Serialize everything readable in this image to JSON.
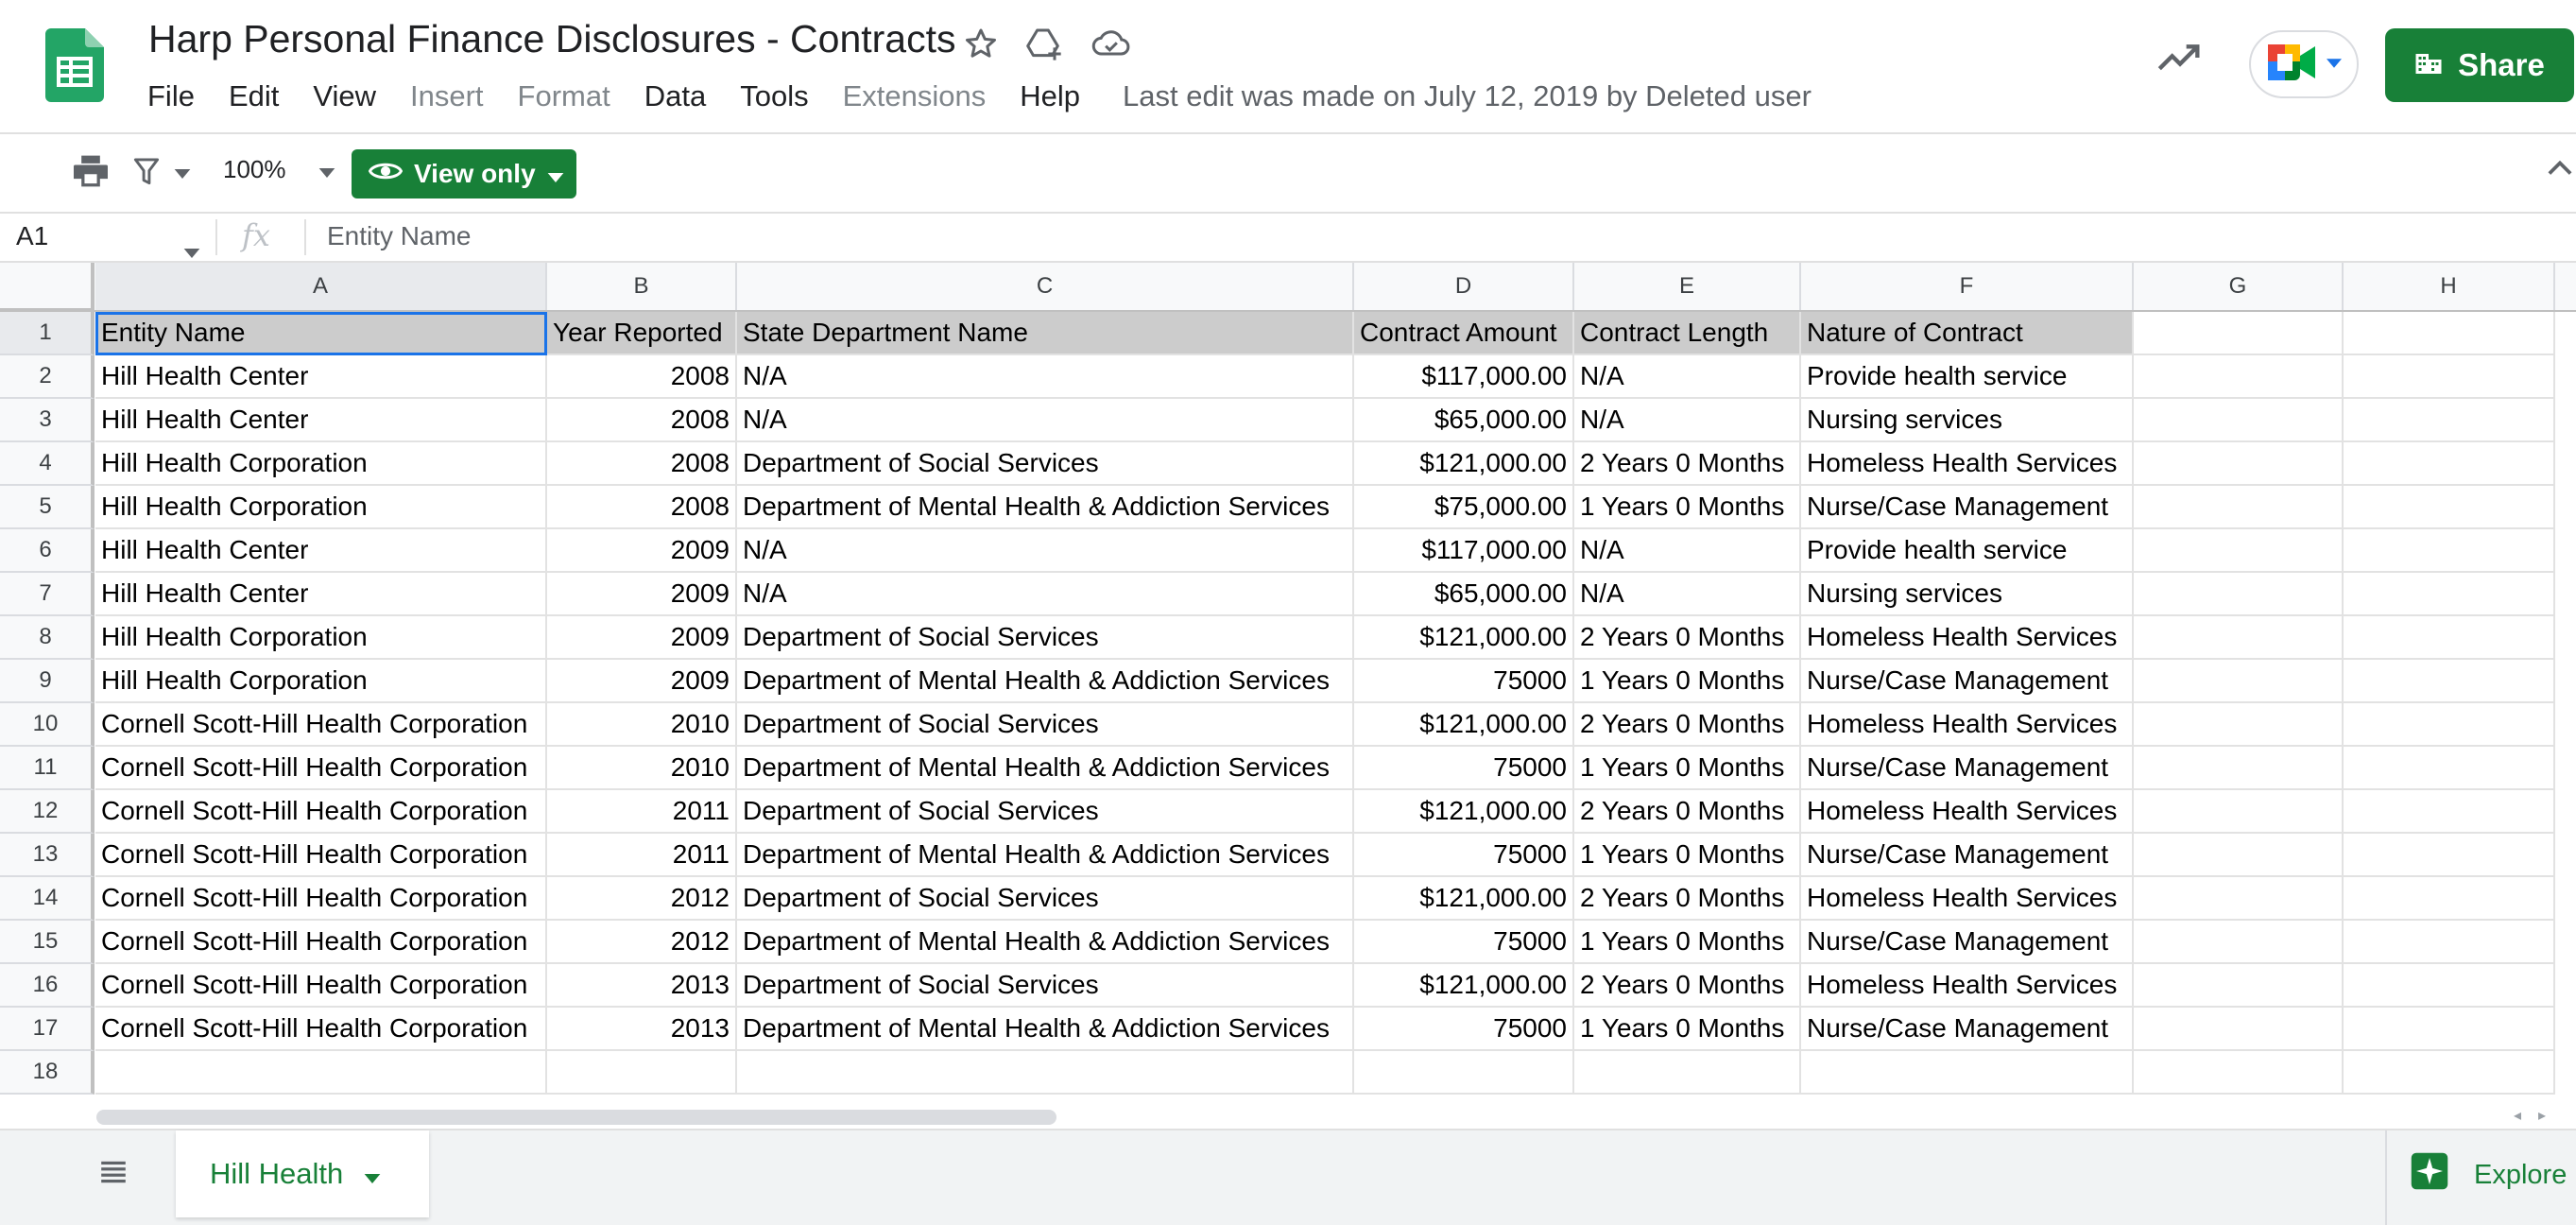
{
  "header": {
    "title": "Harp Personal Finance Disclosures - Contracts",
    "menu": [
      {
        "label": "File",
        "disabled": false
      },
      {
        "label": "Edit",
        "disabled": false
      },
      {
        "label": "View",
        "disabled": false
      },
      {
        "label": "Insert",
        "disabled": true
      },
      {
        "label": "Format",
        "disabled": true
      },
      {
        "label": "Data",
        "disabled": false
      },
      {
        "label": "Tools",
        "disabled": false
      },
      {
        "label": "Extensions",
        "disabled": true
      },
      {
        "label": "Help",
        "disabled": false
      }
    ],
    "last_edit": "Last edit was made on July 12, 2019 by Deleted user",
    "share_label": "Share"
  },
  "toolbar": {
    "zoom": "100%",
    "view_only_label": "View only"
  },
  "formula_bar": {
    "name_box": "A1",
    "fx": "fx",
    "content": "Entity Name"
  },
  "sheet": {
    "columns": [
      "A",
      "B",
      "C",
      "D",
      "E",
      "F",
      "G",
      "H"
    ],
    "selected_cell": "A1",
    "rows": [
      [
        "Entity Name",
        "Year Reported",
        "State Department Name",
        "Contract Amount",
        "Contract Length",
        "Nature of Contract"
      ],
      [
        "Hill Health Center",
        "2008",
        "N/A",
        "$117,000.00",
        "N/A",
        "Provide health service"
      ],
      [
        "Hill Health Center",
        "2008",
        "N/A",
        "$65,000.00",
        "N/A",
        "Nursing services"
      ],
      [
        "Hill Health Corporation",
        "2008",
        "Department of Social Services",
        "$121,000.00",
        "2 Years 0 Months",
        "Homeless Health Services"
      ],
      [
        "Hill Health Corporation",
        "2008",
        "Department of Mental Health & Addiction Services",
        "$75,000.00",
        "1 Years 0 Months",
        "Nurse/Case Management"
      ],
      [
        "Hill Health Center",
        "2009",
        "N/A",
        "$117,000.00",
        "N/A",
        "Provide health service"
      ],
      [
        "Hill Health Center",
        "2009",
        "N/A",
        "$65,000.00",
        "N/A",
        "Nursing services"
      ],
      [
        "Hill Health Corporation",
        "2009",
        "Department of Social Services",
        "$121,000.00",
        "2 Years 0 Months",
        "Homeless Health Services"
      ],
      [
        "Hill Health Corporation",
        "2009",
        "Department of Mental Health & Addiction Services",
        "75000",
        "1 Years 0 Months",
        "Nurse/Case Management"
      ],
      [
        "Cornell Scott-Hill Health Corporation",
        "2010",
        "Department of Social Services",
        "$121,000.00",
        "2 Years 0 Months",
        "Homeless Health Services"
      ],
      [
        "Cornell Scott-Hill Health Corporation",
        "2010",
        "Department of Mental Health & Addiction Services",
        "75000",
        "1 Years 0 Months",
        "Nurse/Case Management"
      ],
      [
        "Cornell Scott-Hill Health Corporation",
        "2011",
        "Department of Social Services",
        "$121,000.00",
        "2 Years 0 Months",
        "Homeless Health Services"
      ],
      [
        "Cornell Scott-Hill Health Corporation",
        "2011",
        "Department of Mental Health & Addiction Services",
        "75000",
        "1 Years 0 Months",
        "Nurse/Case Management"
      ],
      [
        "Cornell Scott-Hill Health Corporation",
        "2012",
        "Department of Social Services",
        "$121,000.00",
        "2 Years 0 Months",
        "Homeless Health Services"
      ],
      [
        "Cornell Scott-Hill Health Corporation",
        "2012",
        "Department of Mental Health & Addiction Services",
        "75000",
        "1 Years 0 Months",
        "Nurse/Case Management"
      ],
      [
        "Cornell Scott-Hill Health Corporation",
        "2013",
        "Department of Social Services",
        "$121,000.00",
        "2 Years 0 Months",
        "Homeless Health Services"
      ],
      [
        "Cornell Scott-Hill Health Corporation",
        "2013",
        "Department of Mental Health & Addiction Services",
        "75000",
        "1 Years 0 Months",
        "Nurse/Case Management"
      ],
      [
        "",
        "",
        "",
        "",
        "",
        ""
      ]
    ]
  },
  "bottom": {
    "sheet_tab": "Hill Health",
    "explore_label": "Explore"
  },
  "colors": {
    "brand_green": "#188038",
    "selection_blue": "#1a73e8",
    "header_row_fill": "#cccccc"
  },
  "icons": [
    "sheets-logo",
    "star-icon",
    "drive-add-icon",
    "cloud-status-icon",
    "trending-icon",
    "meet-icon",
    "print-icon",
    "filter-icon",
    "eye-icon",
    "chevron-up-icon",
    "all-sheets-icon",
    "explore-icon"
  ]
}
